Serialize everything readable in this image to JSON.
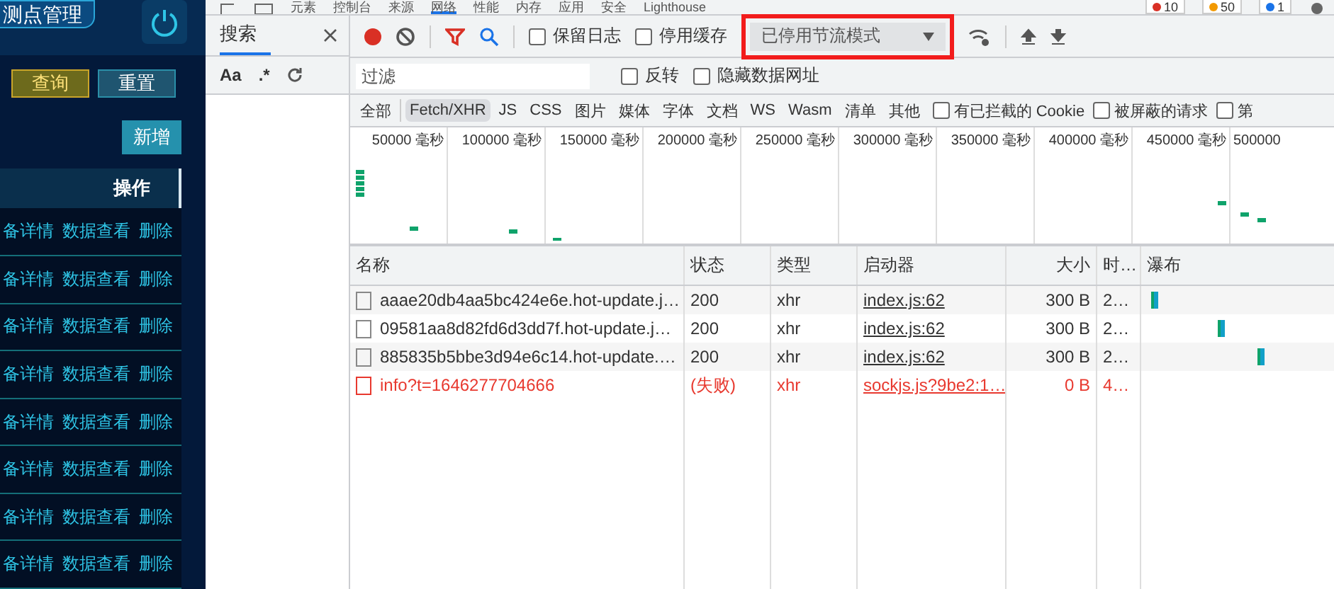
{
  "app": {
    "title": "测点管理",
    "buttons": [
      {
        "label": "查询",
        "kind": "primary"
      },
      {
        "label": "重置",
        "kind": "secondary"
      }
    ],
    "add_button": "新增",
    "table": {
      "header": "操作",
      "rows": [
        {
          "actions": [
            "备详情",
            "数据查看",
            "删除"
          ]
        },
        {
          "actions": [
            "备详情",
            "数据查看",
            "删除"
          ]
        },
        {
          "actions": [
            "备详情",
            "数据查看",
            "删除"
          ]
        },
        {
          "actions": [
            "备详情",
            "数据查看",
            "删除"
          ]
        },
        {
          "actions": [
            "备详情",
            "数据查看",
            "删除"
          ]
        },
        {
          "actions": [
            "备详情",
            "数据查看",
            "删除"
          ]
        },
        {
          "actions": [
            "备详情",
            "数据查看",
            "删除"
          ]
        },
        {
          "actions": [
            "备详情",
            "数据查看",
            "删除"
          ]
        }
      ]
    }
  },
  "devtools": {
    "tabs": [
      {
        "label": "元素",
        "selected": false
      },
      {
        "label": "控制台",
        "selected": false
      },
      {
        "label": "来源",
        "selected": false
      },
      {
        "label": "网络",
        "selected": true
      },
      {
        "label": "性能",
        "selected": false
      },
      {
        "label": "内存",
        "selected": false
      },
      {
        "label": "应用",
        "selected": false
      },
      {
        "label": "安全",
        "selected": false
      },
      {
        "label": "Lighthouse",
        "selected": false
      }
    ],
    "badges": [
      {
        "kind": "error",
        "count": "10"
      },
      {
        "kind": "warning",
        "count": "50"
      },
      {
        "kind": "message",
        "count": "1"
      }
    ],
    "search_panel": {
      "title": "搜索",
      "options": [
        "Aa",
        ".*"
      ]
    },
    "network": {
      "recording": true,
      "checks": [
        {
          "label": "保留日志",
          "checked": false
        },
        {
          "label": "停用缓存",
          "checked": false
        }
      ],
      "throttling": {
        "value": "已停用节流模式",
        "highlighted": true
      },
      "filter": {
        "placeholder": "过滤"
      },
      "filter_checks": [
        {
          "label": "反转",
          "checked": false
        },
        {
          "label": "隐藏数据网址",
          "checked": false
        }
      ],
      "types": [
        {
          "label": "全部",
          "selected": false
        },
        {
          "label": "Fetch/XHR",
          "selected": true
        },
        {
          "label": "JS",
          "selected": false
        },
        {
          "label": "CSS",
          "selected": false
        },
        {
          "label": "图片",
          "selected": false
        },
        {
          "label": "媒体",
          "selected": false
        },
        {
          "label": "字体",
          "selected": false
        },
        {
          "label": "文档",
          "selected": false
        },
        {
          "label": "WS",
          "selected": false
        },
        {
          "label": "Wasm",
          "selected": false
        },
        {
          "label": "清单",
          "selected": false
        },
        {
          "label": "其他",
          "selected": false
        }
      ],
      "type_checks": [
        {
          "label": "有已拦截的 Cookie",
          "checked": false
        },
        {
          "label": "被屏蔽的请求",
          "checked": false
        },
        {
          "label": "第",
          "checked": false
        }
      ],
      "overview": {
        "ticks": [
          {
            "label": "50000 毫秒"
          },
          {
            "label": "100000 毫秒"
          },
          {
            "label": "150000 毫秒"
          },
          {
            "label": "200000 毫秒"
          },
          {
            "label": "250000 毫秒"
          },
          {
            "label": "300000 毫秒"
          },
          {
            "label": "350000 毫秒"
          },
          {
            "label": "400000 毫秒"
          },
          {
            "label": "450000 毫秒"
          },
          {
            "label": "500000"
          }
        ]
      },
      "table": {
        "columns": [
          "名称",
          "状态",
          "类型",
          "启动器",
          "大小",
          "时…",
          "瀑布"
        ],
        "rows": [
          {
            "name": "aaae20db4aa5bc424e6e.hot-update.j…",
            "status": "200",
            "type": "xhr",
            "initiator": "index.js:62",
            "size": "300 B",
            "time": "2…",
            "failed": false
          },
          {
            "name": "09581aa8d82fd6d3dd7f.hot-update.j…",
            "status": "200",
            "type": "xhr",
            "initiator": "index.js:62",
            "size": "300 B",
            "time": "2…",
            "failed": false
          },
          {
            "name": "885835b5bbe3d94e6c14.hot-update.…",
            "status": "200",
            "type": "xhr",
            "initiator": "index.js:62",
            "size": "300 B",
            "time": "2…",
            "failed": false
          },
          {
            "name": "info?t=1646277704666",
            "status": "(失败)",
            "type": "xhr",
            "initiator": "sockjs.js?9be2:1…",
            "size": "0 B",
            "time": "4…",
            "failed": true
          }
        ]
      }
    }
  }
}
